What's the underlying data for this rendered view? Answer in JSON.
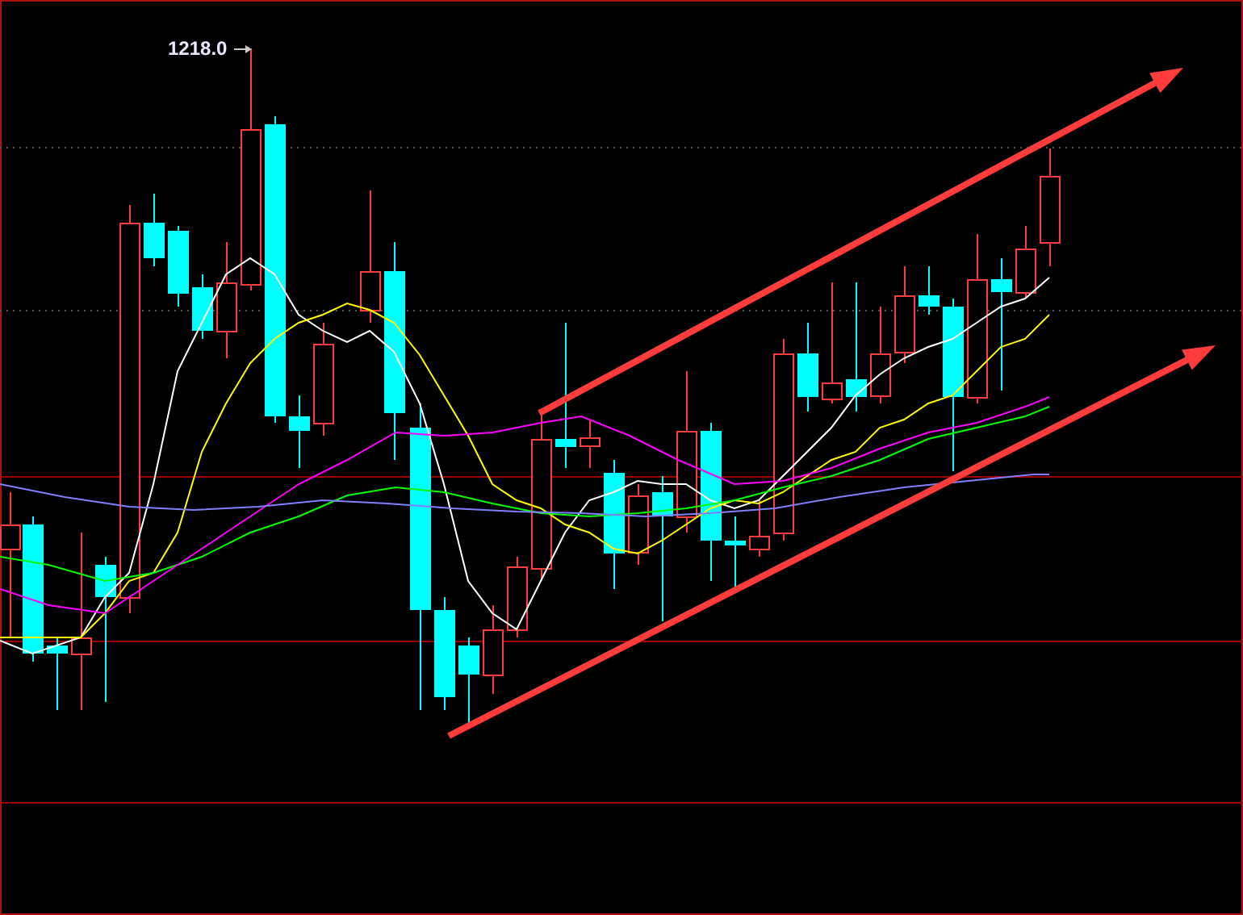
{
  "chart": {
    "peak_label": "1218.0"
  }
}
